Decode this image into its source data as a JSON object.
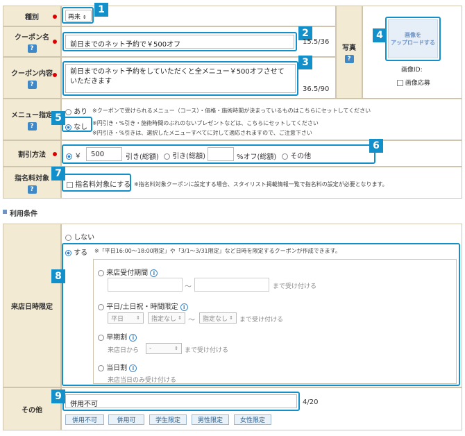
{
  "form": {
    "type": {
      "label": "種別",
      "value": "再来",
      "arrow": "⇕"
    },
    "coupon_name": {
      "label": "クーポン名",
      "value": "前日までのネット予約で￥500オフ",
      "count": "15.5/36"
    },
    "coupon_content": {
      "label": "クーポン内容",
      "value": "前日までのネット予約をしていただくと全メニュー￥500オフさせていただきます",
      "count": "36.5/90"
    },
    "photo": {
      "label": "写真",
      "upload_label": "画像を\nアップロードする",
      "image_id_label": "画像ID:",
      "image_entry_label": "画像応募"
    },
    "menu": {
      "label": "メニュー指定",
      "option_yes": "あり",
      "option_yes_note": "※クーポンで受けられるメニュー（コース）・価格・施術時間が決まっているものはこちらにセットしてください",
      "option_no": "なし",
      "option_no_note1": "※円引き・%引き・施術時間のぶれのないプレゼントなどは、こちらにセットしてください",
      "option_no_note2": "※円引き・%引きは、選択したメニューすべてに対して適応されますので、ご注意下さい"
    },
    "discount": {
      "label": "割引方法",
      "yen": "￥",
      "amount": "500",
      "opt1": "引き(総額)",
      "opt2": "引き(総額)",
      "percent_suffix": "%オフ(総額)",
      "opt3": "その他"
    },
    "nomination": {
      "label": "指名料対象",
      "checkbox_label": "指名料対象にする",
      "note": "※指名料対象クーポンに設定する場合、スタイリスト掲載情報一覧で指名料の設定が必要となります。"
    }
  },
  "conditions": {
    "section_title": "利用条件",
    "visit": {
      "label": "来店日時限定",
      "option_none": "しない",
      "option_do": "する",
      "option_do_note": "※「平日16:00〜18:00限定」や「3/1〜3/31限定」など日時を限定するクーポンが作成できます。",
      "reception_period": "来店受付期間",
      "tilde": "〜",
      "until_accept": "まで受け付ける",
      "weekday_holiday": "平日/土日祝・時間限定",
      "sel_weekday": "平日",
      "sel_none1": "指定なし",
      "sel_none2": "指定なし",
      "early": "早期割",
      "early_from": "来店日から",
      "early_sel": "-",
      "sameday": "当日割",
      "sameday_note": "来店当日のみ受け付ける"
    },
    "other": {
      "label": "その他",
      "value": "併用不可",
      "count": "4/20",
      "tags": [
        "併用不可",
        "併用可",
        "学生限定",
        "男性限定",
        "女性限定"
      ]
    }
  },
  "badges": [
    "1",
    "2",
    "3",
    "4",
    "5",
    "6",
    "7",
    "8",
    "9"
  ],
  "icons": {
    "help": "?",
    "info": "i"
  },
  "colors": {
    "accent": "#1390c9",
    "label_bg": "#f3ead4",
    "required": "#dd0000"
  }
}
